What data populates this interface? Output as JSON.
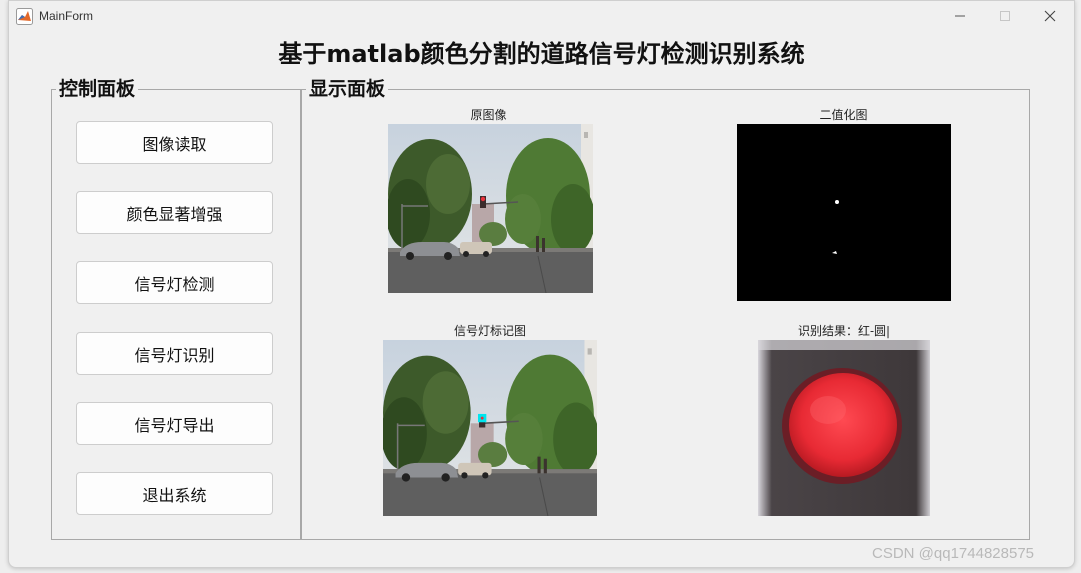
{
  "window": {
    "title": "MainForm"
  },
  "app": {
    "title": "基于matlab颜色分割的道路信号灯检测识别系统"
  },
  "control_panel": {
    "legend": "控制面板",
    "buttons": [
      {
        "label": "图像读取"
      },
      {
        "label": "颜色显著增强"
      },
      {
        "label": "信号灯检测"
      },
      {
        "label": "信号灯识别"
      },
      {
        "label": "信号灯导出"
      },
      {
        "label": "退出系统"
      }
    ]
  },
  "display_panel": {
    "legend": "显示面板",
    "axes": {
      "original": {
        "title": "原图像"
      },
      "binary": {
        "title": "二值化图"
      },
      "marked": {
        "title": "信号灯标记图"
      },
      "result": {
        "title": "识别结果：红-圆|"
      }
    }
  },
  "watermark": "CSDN @qq1744828575",
  "colors": {
    "window_bg": "#f0f0f0",
    "signal_red": "#e8323c",
    "marker_cyan": "#00e5ee"
  }
}
